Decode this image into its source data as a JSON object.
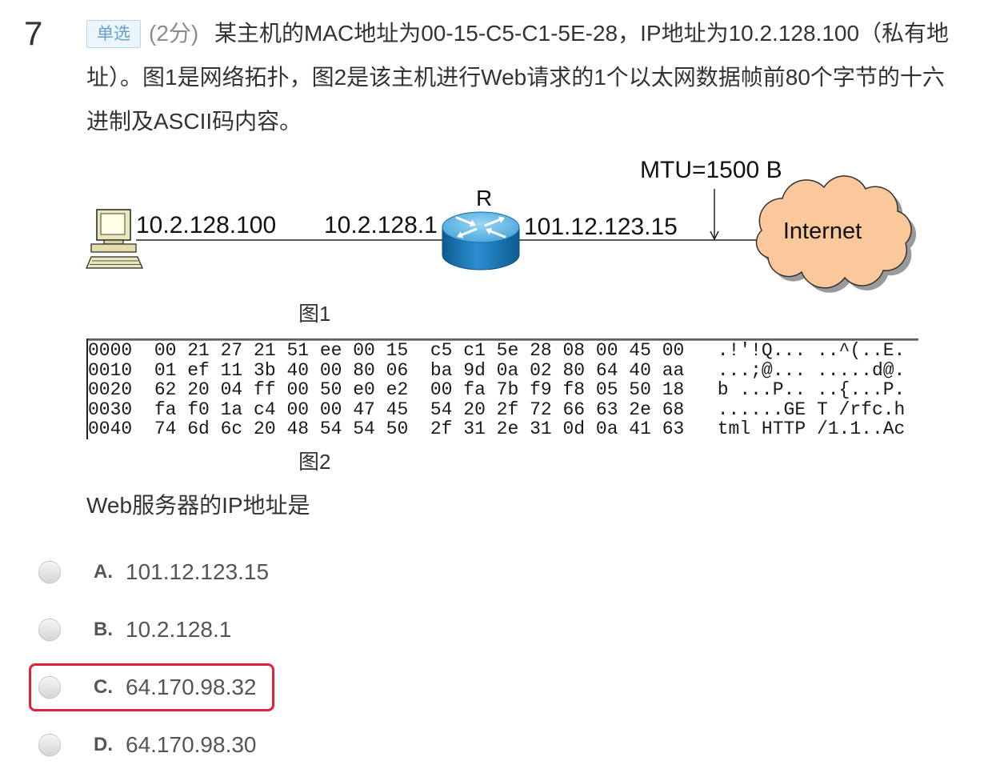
{
  "question": {
    "number": "7",
    "type_badge": "单选",
    "score": "(2分)",
    "stem_lines": [
      "某主机的MAC地址为00-15-C5-C1-5E-28，IP地址为10.2.128.100（私有地",
      "址）。图1是网络拓扑，图2是该主机进行Web请求的1个以太网数据帧前80个字节的十六",
      "进制及ASCII码内容。"
    ],
    "prompt": "Web服务器的IP地址是"
  },
  "figure1": {
    "caption": "图1",
    "mtu_label": "MTU=1500 B",
    "router_label": "R",
    "host_ip": "10.2.128.100",
    "router_lan_ip": "10.2.128.1",
    "router_wan_ip": "101.12.123.15",
    "cloud_label": "Internet",
    "icons": {
      "host": "computer-icon",
      "router": "router-icon",
      "cloud": "internet-cloud-icon",
      "mtu_marker": "down-arrow-icon"
    }
  },
  "figure2": {
    "caption": "图2",
    "rows": [
      {
        "offset": "0000",
        "hex": "00 21 27 21 51 ee 00 15  c5 c1 5e 28 08 00 45 00",
        "ascii": ".!'!Q... ..^(..E."
      },
      {
        "offset": "0010",
        "hex": "01 ef 11 3b 40 00 80 06  ba 9d 0a 02 80 64 40 aa",
        "ascii": "...;@... .....d@."
      },
      {
        "offset": "0020",
        "hex": "62 20 04 ff 00 50 e0 e2  00 fa 7b f9 f8 05 50 18",
        "ascii": "b ...P.. ..{...P."
      },
      {
        "offset": "0030",
        "hex": "fa f0 1a c4 00 00 47 45  54 20 2f 72 66 63 2e 68",
        "ascii": "......GE T /rfc.h"
      },
      {
        "offset": "0040",
        "hex": "74 6d 6c 20 48 54 54 50  2f 31 2e 31 0d 0a 41 63",
        "ascii": "tml HTTP /1.1..Ac"
      }
    ]
  },
  "options": [
    {
      "letter": "A.",
      "text": "101.12.123.15",
      "selected": false,
      "highlighted": false
    },
    {
      "letter": "B.",
      "text": "10.2.128.1",
      "selected": false,
      "highlighted": false
    },
    {
      "letter": "C.",
      "text": "64.170.98.32",
      "selected": false,
      "highlighted": true
    },
    {
      "letter": "D.",
      "text": "64.170.98.30",
      "selected": false,
      "highlighted": false
    }
  ],
  "colors": {
    "text": "#333333",
    "muted": "#8c8c8c",
    "option_text": "#555555",
    "badge_bg": "#eaf5fc",
    "badge_border": "#b4d8ee",
    "badge_text": "#6b9fc8",
    "highlight": "#e0223a",
    "cloud_fill": "#fbc89c",
    "router_blue": "#2b8fcf"
  }
}
